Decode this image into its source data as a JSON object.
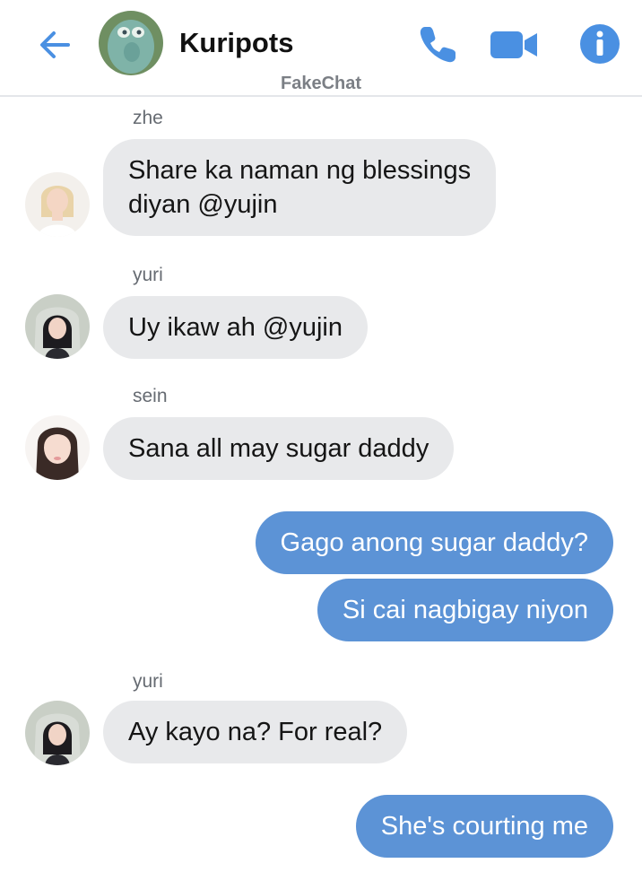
{
  "header": {
    "title": "Kuripots",
    "subtitle": "FakeChat",
    "back_icon": "arrow-left-icon",
    "call_icon": "phone-icon",
    "video_icon": "video-camera-icon",
    "info_icon": "info-icon",
    "accent": "#4a90e2"
  },
  "messages": [
    {
      "sender": "zhe",
      "lines": [
        "Share ka naman ng blessings",
        "diyan @yujin"
      ],
      "direction": "incoming"
    },
    {
      "sender": "yuri",
      "lines": [
        "Uy ikaw ah @yujin"
      ],
      "direction": "incoming"
    },
    {
      "sender": "sein",
      "lines": [
        "Sana all may sugar daddy"
      ],
      "direction": "incoming"
    },
    {
      "lines": [
        "Gago anong sugar daddy?"
      ],
      "direction": "outgoing"
    },
    {
      "lines": [
        "Si cai nagbigay niyon"
      ],
      "direction": "outgoing"
    },
    {
      "sender": "yuri",
      "lines": [
        "Ay kayo na? For real?"
      ],
      "direction": "incoming"
    },
    {
      "lines": [
        "She's courting me"
      ],
      "direction": "outgoing"
    }
  ],
  "colors": {
    "incoming_bubble": "#e8e9eb",
    "outgoing_bubble": "#5c93d6",
    "sender_label": "#666b72"
  }
}
